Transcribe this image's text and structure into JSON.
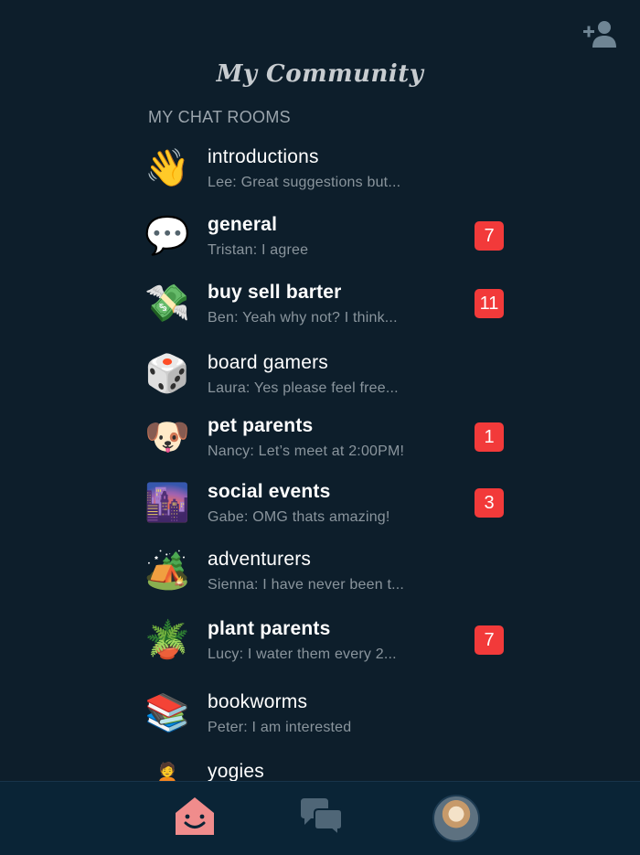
{
  "header": {
    "title": "My Community",
    "add_user_icon": "add-user-icon"
  },
  "section_label": "MY CHAT ROOMS",
  "rooms": [
    {
      "emoji": "👋",
      "name": "introductions",
      "preview": "Lee: Great suggestions but...",
      "badge": "",
      "unread": false
    },
    {
      "emoji": "💬",
      "name": "general",
      "preview": "Tristan: I agree",
      "badge": "7",
      "unread": true
    },
    {
      "emoji": "💸",
      "name": "buy sell barter",
      "preview": "Ben: Yeah why not? I think...",
      "badge": "11",
      "unread": true
    },
    {
      "emoji": "🎲",
      "name": "board gamers",
      "preview": "Laura: Yes please feel free...",
      "badge": "",
      "unread": false
    },
    {
      "emoji": "🐶",
      "name": "pet parents",
      "preview": "Nancy: Let’s meet at 2:00PM!",
      "badge": "1",
      "unread": true
    },
    {
      "emoji": "🌆",
      "name": "social events",
      "preview": "Gabe: OMG thats amazing!",
      "badge": "3",
      "unread": true
    },
    {
      "emoji": "🏕️",
      "name": "adventurers",
      "preview": "Sienna: I have never been t...",
      "badge": "",
      "unread": false
    },
    {
      "emoji": "🪴",
      "name": "plant parents",
      "preview": "Lucy: I water them every 2...",
      "badge": "7",
      "unread": true
    },
    {
      "emoji": "📚",
      "name": "bookworms",
      "preview": "Peter: I am interested",
      "badge": "",
      "unread": false
    },
    {
      "emoji": "🧘",
      "name": "yogies",
      "preview": "",
      "badge": "",
      "unread": false
    }
  ],
  "tabbar": {
    "tabs": [
      {
        "icon": "community-icon",
        "active": true
      },
      {
        "icon": "chat-bubbles-icon",
        "active": false
      },
      {
        "icon": "profile-avatar",
        "active": false
      }
    ],
    "colors": {
      "active": "#f08c8c",
      "inactive": "#4f6677",
      "background": "#0a2436"
    }
  },
  "colors": {
    "background": "#0d1e2b",
    "badge": "#f23a3a",
    "title": "#c7ccd0",
    "preview": "#8a959d"
  }
}
